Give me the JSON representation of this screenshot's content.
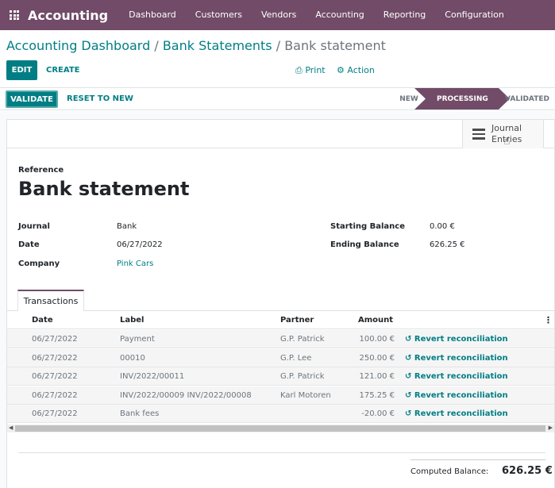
{
  "app": {
    "name": "Accounting"
  },
  "nav": {
    "items": [
      "Dashboard",
      "Customers",
      "Vendors",
      "Accounting",
      "Reporting",
      "Configuration"
    ]
  },
  "breadcrumb": {
    "part1": "Accounting Dashboard",
    "part2": "Bank Statements",
    "current": "Bank statement",
    "sep": "/"
  },
  "control": {
    "edit": "EDIT",
    "create": "CREATE",
    "print": "Print",
    "action": "Action"
  },
  "statusbar": {
    "validate": "VALIDATE",
    "reset": "RESET TO NEW",
    "stages": [
      "NEW",
      "PROCESSING",
      "VALIDATED"
    ],
    "active_stage": "PROCESSING"
  },
  "smart_button": {
    "label_line1": "Journal",
    "label_line2": "Entries"
  },
  "form": {
    "reference_label": "Reference",
    "title": "Bank statement",
    "journal_label": "Journal",
    "journal_value": "Bank",
    "date_label": "Date",
    "date_value": "06/27/2022",
    "company_label": "Company",
    "company_value": "Pink Cars",
    "starting_label": "Starting Balance",
    "starting_value": "0.00 €",
    "ending_label": "Ending Balance",
    "ending_value": "626.25 €"
  },
  "tabs": {
    "active": "Transactions"
  },
  "table": {
    "headers": {
      "date": "Date",
      "label": "Label",
      "partner": "Partner",
      "amount": "Amount"
    },
    "rows": [
      {
        "date": "06/27/2022",
        "label": "Payment",
        "partner": "G.P. Patrick",
        "amount": "100.00 €",
        "action": "Revert reconciliation"
      },
      {
        "date": "06/27/2022",
        "label": "00010",
        "partner": "G.P. Lee",
        "amount": "250.00 €",
        "action": "Revert reconciliation"
      },
      {
        "date": "06/27/2022",
        "label": "INV/2022/00011",
        "partner": "G.P. Patrick",
        "amount": "121.00 €",
        "action": "Revert reconciliation"
      },
      {
        "date": "06/27/2022",
        "label": "INV/2022/00009 INV/2022/00008",
        "partner": "Karl Motoren",
        "amount": "175.25 €",
        "action": "Revert reconciliation"
      },
      {
        "date": "06/27/2022",
        "label": "Bank fees",
        "partner": "",
        "amount": "-20.00 €",
        "action": "Revert reconciliation"
      }
    ]
  },
  "totals": {
    "computed_label": "Computed Balance:",
    "computed_value": "626.25 €"
  },
  "colors": {
    "brand": "#714b67",
    "accent": "#017e84"
  }
}
